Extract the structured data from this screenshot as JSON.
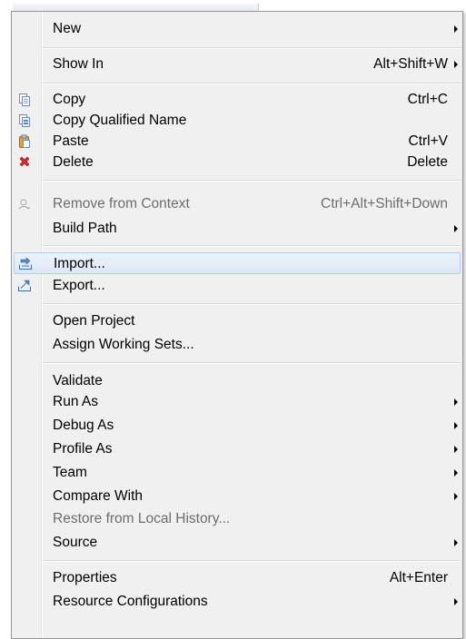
{
  "menu": {
    "items": [
      {
        "label": "New",
        "shortcut": "",
        "submenu": true,
        "enabled": true,
        "icon": ""
      },
      {
        "label": "Show In",
        "shortcut": "Alt+Shift+W",
        "submenu": true,
        "enabled": true,
        "icon": ""
      },
      {
        "label": "Copy",
        "shortcut": "Ctrl+C",
        "submenu": false,
        "enabled": true,
        "icon": "copy-icon"
      },
      {
        "label": "Copy Qualified Name",
        "shortcut": "",
        "submenu": false,
        "enabled": true,
        "icon": "copy-qualified-name-icon"
      },
      {
        "label": "Paste",
        "shortcut": "Ctrl+V",
        "submenu": false,
        "enabled": true,
        "icon": "paste-icon"
      },
      {
        "label": "Delete",
        "shortcut": "Delete",
        "submenu": false,
        "enabled": true,
        "icon": "delete-icon"
      },
      {
        "label": "Remove from Context",
        "shortcut": "Ctrl+Alt+Shift+Down",
        "submenu": false,
        "enabled": false,
        "icon": "remove-from-context-icon"
      },
      {
        "label": "Build Path",
        "shortcut": "",
        "submenu": true,
        "enabled": true,
        "icon": ""
      },
      {
        "label": "Import...",
        "shortcut": "",
        "submenu": false,
        "enabled": true,
        "icon": "import-icon",
        "highlighted": true
      },
      {
        "label": "Export...",
        "shortcut": "",
        "submenu": false,
        "enabled": true,
        "icon": "export-icon"
      },
      {
        "label": "Open Project",
        "shortcut": "",
        "submenu": false,
        "enabled": true,
        "icon": ""
      },
      {
        "label": "Assign Working Sets...",
        "shortcut": "",
        "submenu": false,
        "enabled": true,
        "icon": ""
      },
      {
        "label": "Validate",
        "shortcut": "",
        "submenu": false,
        "enabled": true,
        "icon": ""
      },
      {
        "label": "Run As",
        "shortcut": "",
        "submenu": true,
        "enabled": true,
        "icon": ""
      },
      {
        "label": "Debug As",
        "shortcut": "",
        "submenu": true,
        "enabled": true,
        "icon": ""
      },
      {
        "label": "Profile As",
        "shortcut": "",
        "submenu": true,
        "enabled": true,
        "icon": ""
      },
      {
        "label": "Team",
        "shortcut": "",
        "submenu": true,
        "enabled": true,
        "icon": ""
      },
      {
        "label": "Compare With",
        "shortcut": "",
        "submenu": true,
        "enabled": true,
        "icon": ""
      },
      {
        "label": "Restore from Local History...",
        "shortcut": "",
        "submenu": false,
        "enabled": false,
        "icon": ""
      },
      {
        "label": "Source",
        "shortcut": "",
        "submenu": true,
        "enabled": true,
        "icon": ""
      },
      {
        "label": "Properties",
        "shortcut": "Alt+Enter",
        "submenu": false,
        "enabled": true,
        "icon": ""
      },
      {
        "label": "Resource Configurations",
        "shortcut": "",
        "submenu": true,
        "enabled": true,
        "icon": ""
      }
    ]
  },
  "colors": {
    "menu_bg": "#f0f0f0",
    "highlight_border": "#aecff7",
    "disabled_text": "#6d6d6d",
    "delete_red": "#d9262b"
  }
}
